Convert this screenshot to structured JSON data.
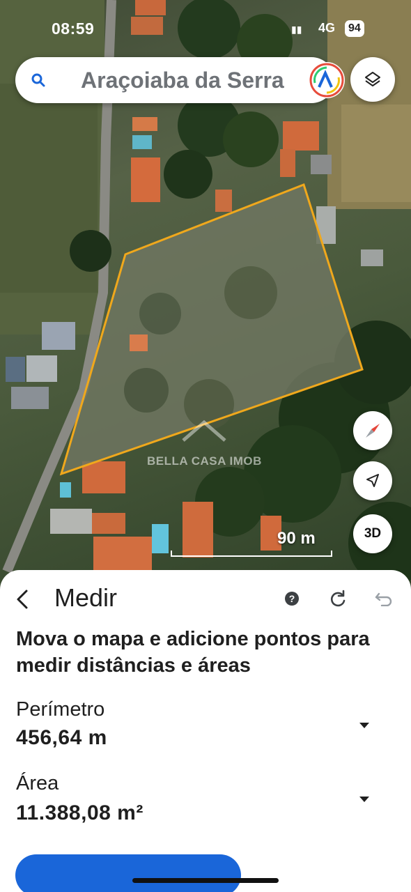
{
  "status_bar": {
    "time": "08:59",
    "network": "4G",
    "battery": "94"
  },
  "search": {
    "text": "Araçoiaba da Serra"
  },
  "map": {
    "watermark": "BELLA CASA IMOB",
    "scale_label": "90 m",
    "btn_3d": "3D",
    "polygon_color": "#f0a81c"
  },
  "sheet": {
    "title": "Medir",
    "instruction": "Mova o mapa e adicione pontos para medir distâncias e áreas",
    "perimeter_label": "Perímetro",
    "perimeter_value": "456,64 m",
    "area_label": "Área",
    "area_value": "11.388,08 m²"
  },
  "colors": {
    "accent_blue": "#1a66d9",
    "compass_red": "#e5453a"
  }
}
